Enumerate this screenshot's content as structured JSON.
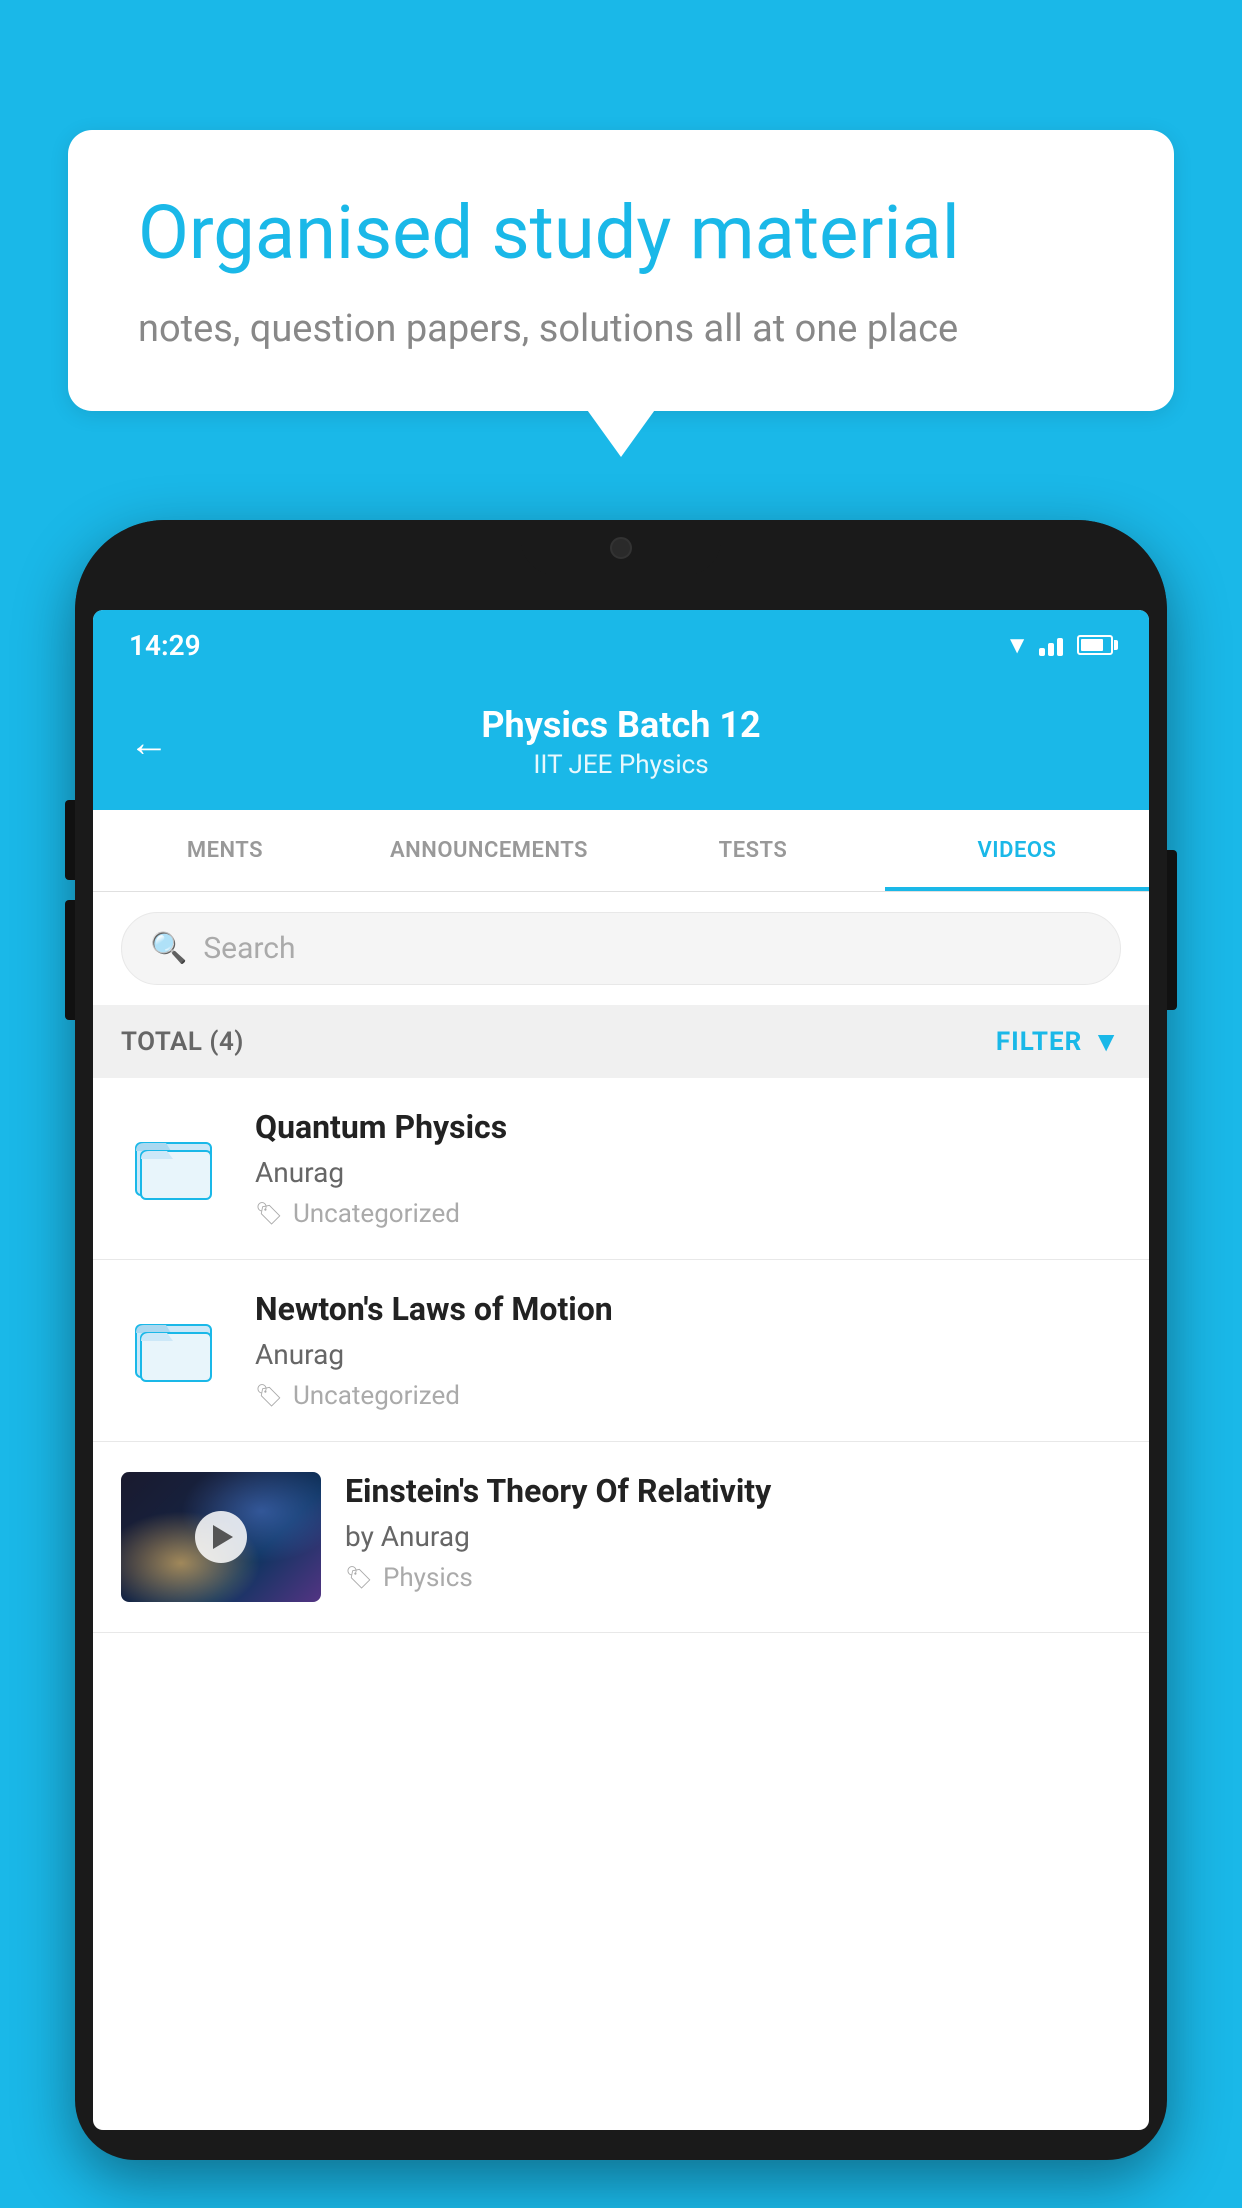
{
  "background_color": "#1ab8e8",
  "speech_bubble": {
    "title": "Organised study material",
    "subtitle": "notes, question papers, solutions all at one place"
  },
  "phone": {
    "status_bar": {
      "time": "14:29"
    },
    "header": {
      "back_label": "←",
      "title": "Physics Batch 12",
      "subtitle": "IIT JEE   Physics"
    },
    "tabs": [
      {
        "label": "MENTS",
        "active": false
      },
      {
        "label": "ANNOUNCEMENTS",
        "active": false
      },
      {
        "label": "TESTS",
        "active": false
      },
      {
        "label": "VIDEOS",
        "active": true
      }
    ],
    "search": {
      "placeholder": "Search"
    },
    "filter_bar": {
      "total": "TOTAL (4)",
      "filter_label": "FILTER"
    },
    "videos": [
      {
        "id": 1,
        "title": "Quantum Physics",
        "author": "Anurag",
        "tag": "Uncategorized",
        "type": "folder"
      },
      {
        "id": 2,
        "title": "Newton's Laws of Motion",
        "author": "Anurag",
        "tag": "Uncategorized",
        "type": "folder"
      },
      {
        "id": 3,
        "title": "Einstein's Theory Of Relativity",
        "author": "by Anurag",
        "tag": "Physics",
        "type": "video"
      }
    ]
  }
}
